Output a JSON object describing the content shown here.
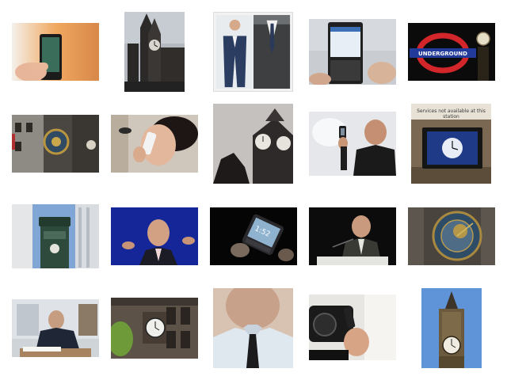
{
  "grid": {
    "rows": 4,
    "columns": 5,
    "background": "#ffffff"
  },
  "images": {
    "hand-smartphone-orange": {
      "subject": "hand holding smartphone on orange background"
    },
    "gothic-clock-tower": {
      "subject": "gothic clock tower"
    },
    "men-in-suits": {
      "subject": "two men in suits"
    },
    "texting-phone": {
      "subject": "hands texting on phone"
    },
    "underground-sign-clock": {
      "subject": "underground roundel sign and clock"
    },
    "astronomical-clock-street": {
      "subject": "astronomical clock on building"
    },
    "woman-on-phone": {
      "subject": "woman talking on phone"
    },
    "big-ben-clock-face": {
      "subject": "clock tower faces"
    },
    "presenter-holding-phone": {
      "subject": "presenter holding phone"
    },
    "station-digital-clock": {
      "subject": "digital station clock screen",
      "caption": "Services not available at this station"
    },
    "street-clock-pillar": {
      "subject": "green street clock pillar"
    },
    "speaker-blue-stage": {
      "subject": "speaker on blue stage"
    },
    "phone-screen-dark": {
      "subject": "phone screen in dark",
      "screen_text": "1:52"
    },
    "man-at-podium": {
      "subject": "man at podium with microphone"
    },
    "astronomical-clock-dial": {
      "subject": "astronomical clock dial"
    },
    "man-reading-papers": {
      "subject": "man reading papers at desk"
    },
    "building-clock": {
      "subject": "clock on building facade"
    },
    "shirt-and-tie": {
      "subject": "man in shirt and tie"
    },
    "hand-phone-camera": {
      "subject": "hand holding phone and camera"
    },
    "big-ben-blue-sky": {
      "subject": "clock tower against blue sky"
    }
  }
}
